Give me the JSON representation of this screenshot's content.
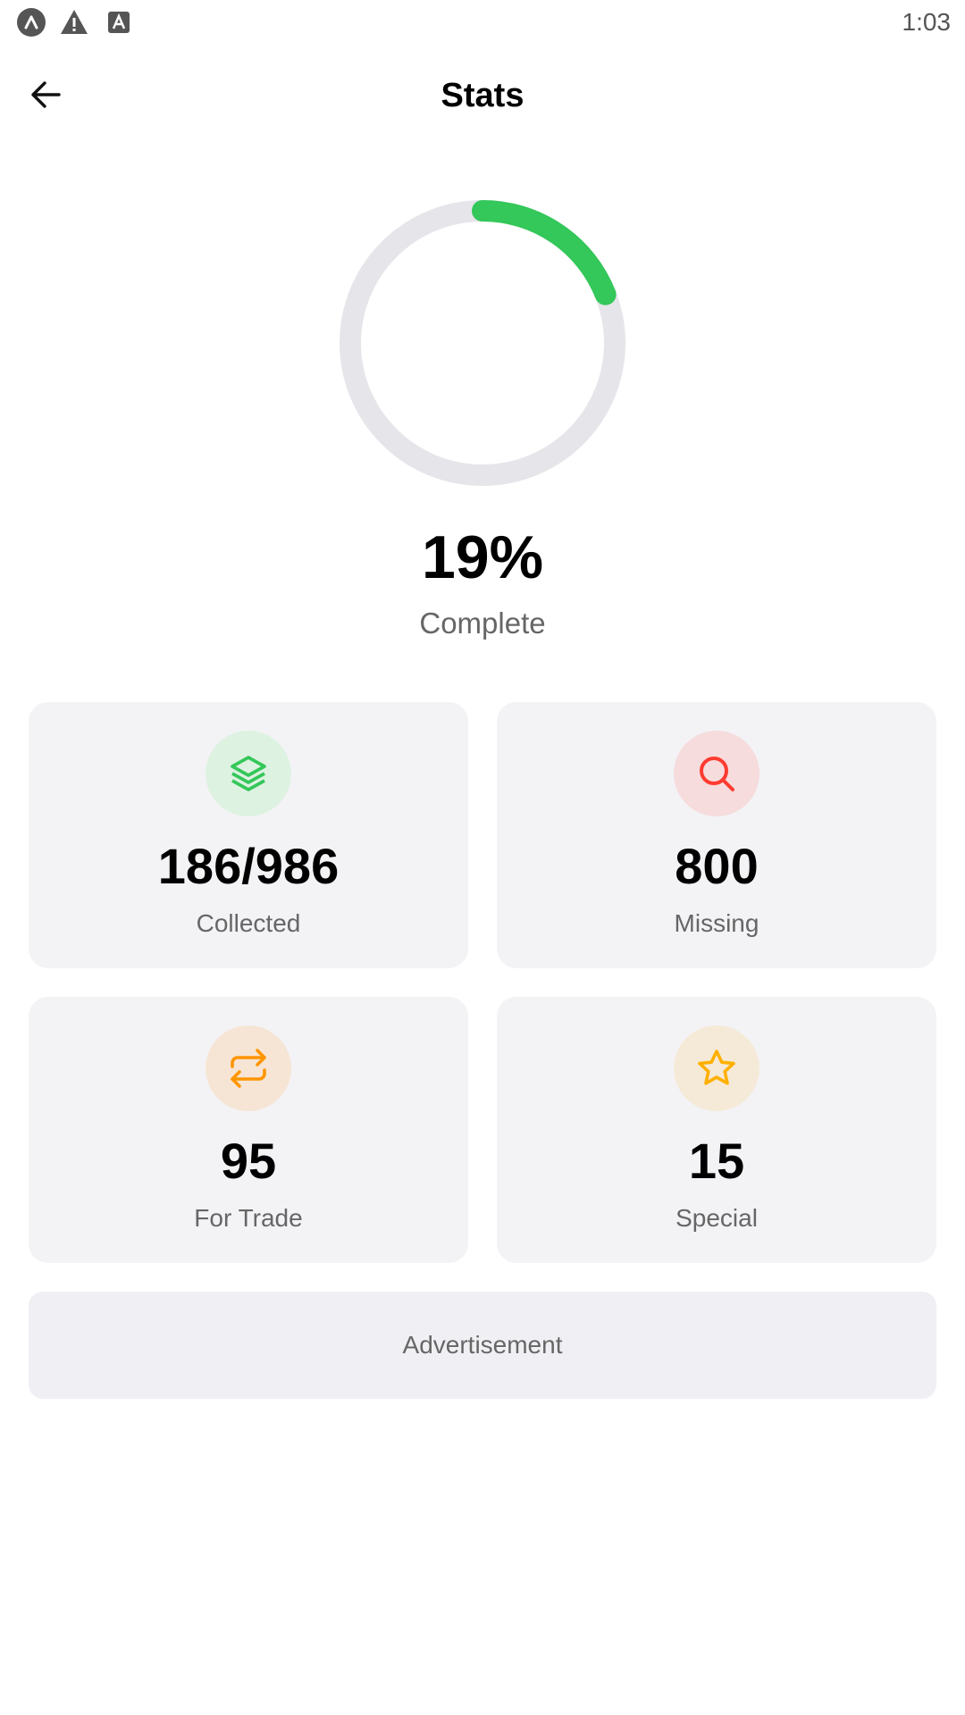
{
  "status_bar": {
    "icons": [
      "app-launcher-icon",
      "warning-icon",
      "text-a-icon"
    ],
    "time": "1:03"
  },
  "header": {
    "title": "Stats",
    "back_icon": "arrow-left-icon"
  },
  "progress": {
    "fraction": 0.19,
    "percent_label": "19%",
    "caption": "Complete",
    "track_color": "#e5e5ea",
    "fill_color": "#34c759"
  },
  "cards": [
    {
      "value": "186/986",
      "label": "Collected",
      "icon": "layers-icon",
      "icon_color": "#34c759",
      "icon_bg": "#def2e2"
    },
    {
      "value": "800",
      "label": "Missing",
      "icon": "search-icon",
      "icon_color": "#ff3b30",
      "icon_bg": "#f6dcdd"
    },
    {
      "value": "95",
      "label": "For Trade",
      "icon": "repeat-icon",
      "icon_color": "#ff9500",
      "icon_bg": "#f6e5d5"
    },
    {
      "value": "15",
      "label": "Special",
      "icon": "star-icon",
      "icon_color": "#ffb000",
      "icon_bg": "#f5ead8"
    }
  ],
  "ad": {
    "label": "Advertisement"
  }
}
